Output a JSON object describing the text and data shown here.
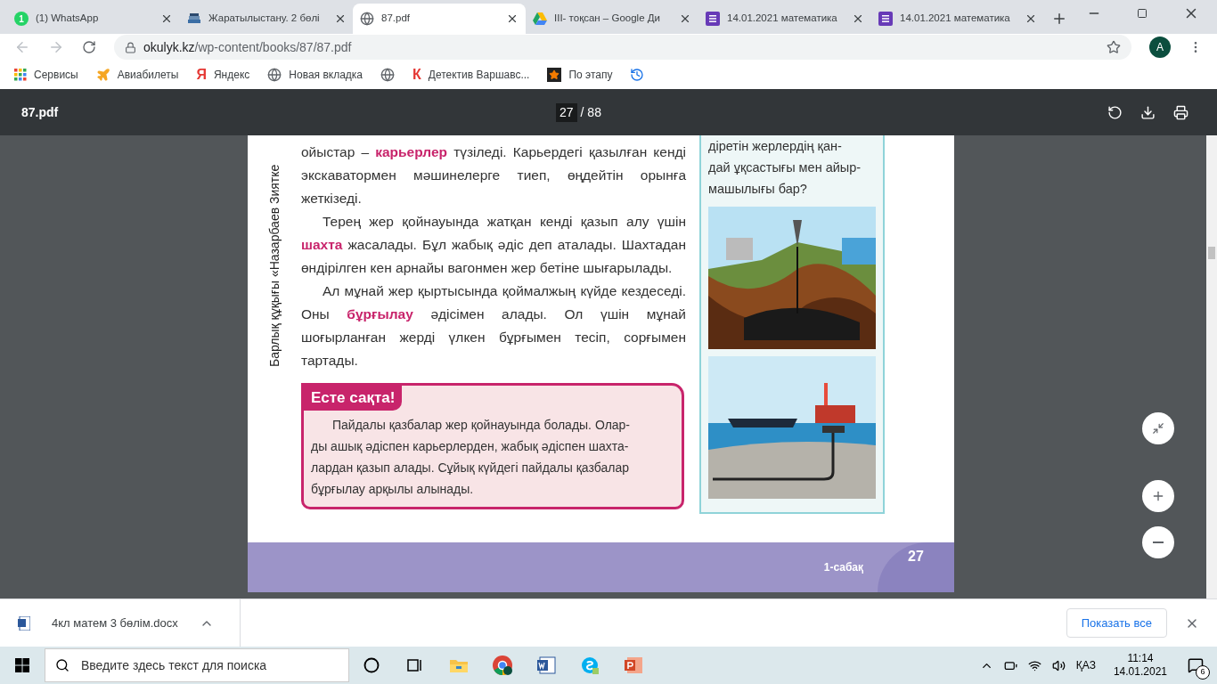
{
  "tabs": [
    {
      "kind": "whatsapp",
      "badge": "1",
      "title": "(1) WhatsApp",
      "selected": false
    },
    {
      "kind": "books",
      "title": "Жаратылыстану. 2 бөлі",
      "selected": false
    },
    {
      "kind": "globe",
      "title": "87.pdf",
      "selected": true
    },
    {
      "kind": "drive",
      "title": "ІІІ- тоқсан – Google Ди",
      "selected": false
    },
    {
      "kind": "forms",
      "title": "14.01.2021 математика",
      "selected": false
    },
    {
      "kind": "forms",
      "title": "14.01.2021 математика",
      "selected": false
    }
  ],
  "address": {
    "domain": "okulyk.kz",
    "path": "/wp-content/books/87/87.pdf"
  },
  "avatar": "A",
  "bookmarks": [
    {
      "kind": "apps",
      "label": "Сервисы"
    },
    {
      "kind": "plane",
      "label": "Авиабилеты"
    },
    {
      "kind": "letter",
      "glyph": "Я",
      "label": "Яндекс"
    },
    {
      "kind": "globe",
      "label": "Новая вкладка"
    },
    {
      "kind": "globe"
    },
    {
      "kind": "letter",
      "glyph": "К",
      "label": "Детектив Варшавс..."
    },
    {
      "kind": "star",
      "label": "По этапу"
    },
    {
      "kind": "history"
    }
  ],
  "pdf_toolbar": {
    "title": "87.pdf",
    "page": "27",
    "total": "/ 88"
  },
  "page": {
    "side_text": "Барлық құқығы «Назарбаев Зиятке",
    "paragraphs": [
      {
        "indent": false,
        "text": "ойыстар – **карьерлер** түзіледі. Карьердегі қазылған кенді экскаватормен мәшинелерге тиеп, өңдейтін орынға жеткізеді."
      },
      {
        "indent": true,
        "text": "Терең жер қойнауында жатқан кенді қазып алу үшін **шахта** жасалады. Бұл жабық әдіс деп аталады. Шахтадан өндірілген кен арнайы вагонмен жер бетіне шығарылады."
      },
      {
        "indent": true,
        "text": "Ал мұнай жер қыртысында қоймалжың күйде кездеседі. Оны **бұрғылау** әдісімен алады. Ол үшін мұнай шоғырланған жерді үлкен бұрғымен тесіп, сорғымен тартады."
      }
    ],
    "note": {
      "title": "Есте сақта!",
      "lines": [
        "Пайдалы қазбалар жер қойнауында болады. Олар-",
        "ды ашық әдіспен карьерлерден, жабық әдіспен шахта-",
        "лардан қазып алады. Сұйық күйдегі пайдалы қазбалар",
        "бұрғылау арқылы алынады."
      ]
    },
    "question": [
      "діретін жерлердің қан-",
      "дай ұқсастығы мен айыр-",
      "машылығы бар?"
    ],
    "footer": {
      "lesson": "1-сабақ",
      "number": "27"
    }
  },
  "downloads": {
    "file": "4кл матем 3 бөлім.docx",
    "button": "Показать все"
  },
  "taskbar": {
    "search_placeholder": "Введите здесь текст для поиска",
    "apps": [
      {
        "kind": "cortana"
      },
      {
        "kind": "taskview"
      },
      {
        "kind": "explorer"
      },
      {
        "kind": "chrome"
      },
      {
        "kind": "word"
      },
      {
        "kind": "skype"
      },
      {
        "kind": "powerpoint"
      }
    ],
    "language": "ҚАЗ",
    "time": "11:14",
    "date": "14.01.2021",
    "notifications": "6"
  }
}
